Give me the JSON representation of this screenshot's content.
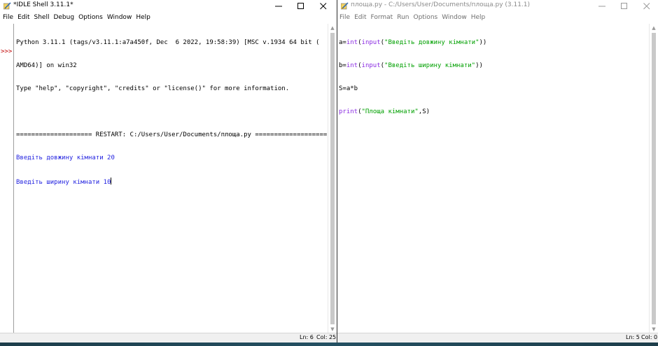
{
  "shell": {
    "title": "*IDLE Shell 3.11.1*",
    "menu": [
      "File",
      "Edit",
      "Shell",
      "Debug",
      "Options",
      "Window",
      "Help"
    ],
    "prompt": ">>>",
    "lines": [
      "Python 3.11.1 (tags/v3.11.1:a7a450f, Dec  6 2022, 19:58:39) [MSC v.1934 64 bit (",
      "AMD64)] on win32",
      "Type \"help\", \"copyright\", \"credits\" or \"license()\" for more information.",
      "",
      "==================== RESTART: C:/Users/User/Documents/площа.py ===================",
      "Введіть довжину кімнати 20",
      "Введіть ширину кімнати 10"
    ],
    "status": {
      "ln": "Ln: 6",
      "col": "Col: 25"
    }
  },
  "editor": {
    "title": "площа.py - C:/Users/User/Documents/площа.py (3.11.1)",
    "menu": [
      "File",
      "Edit",
      "Format",
      "Run",
      "Options",
      "Window",
      "Help"
    ],
    "code": {
      "line1": {
        "a": "a=",
        "b": "int",
        "c": "(",
        "d": "input",
        "e": "(",
        "f": "\"Введіть довжину кімнати\"",
        "g": "))"
      },
      "line2": {
        "a": "b=",
        "b": "int",
        "c": "(",
        "d": "input",
        "e": "(",
        "f": "\"Введіть ширину кімнати\"",
        "g": "))"
      },
      "line3": "S=a*b",
      "line4": {
        "a": "print",
        "b": "(",
        "c": "\"Площа кімнати\"",
        "d": ",S)"
      }
    },
    "status": {
      "ln": "Ln: 5",
      "col": "Col: 0"
    }
  },
  "colors": {
    "keyword": "#8a2be2",
    "string": "#00a000",
    "shell_output": "#2323e0",
    "prompt": "#c00000"
  },
  "icons": [
    "idle-app-icon",
    "minimize-icon",
    "maximize-icon",
    "close-icon",
    "scroll-up-arrow-icon",
    "scroll-down-arrow-icon"
  ]
}
